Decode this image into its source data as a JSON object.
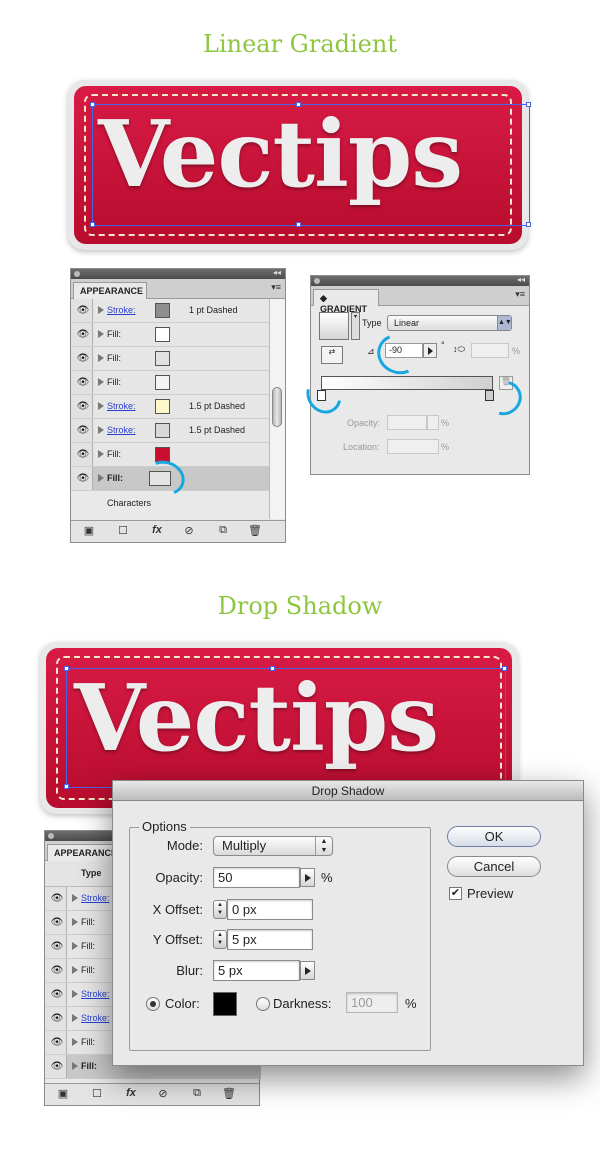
{
  "headings": {
    "linear": "Linear Gradient",
    "shadow": "Drop Shadow"
  },
  "badge": {
    "text": "Vectips",
    "color_top": "#d81b45",
    "color_bottom": "#b80c2e",
    "stitch": "#f3e8c8"
  },
  "appearance1": {
    "tab": "APPEARANCE",
    "rows": [
      {
        "label": "Stroke:",
        "link": true,
        "swatch": "#8e8e8e",
        "value": "1 pt Dashed"
      },
      {
        "label": "Fill:",
        "link": false,
        "swatch": "#ffffff",
        "value": ""
      },
      {
        "label": "Fill:",
        "link": false,
        "swatch": "#e1e1e1",
        "value": ""
      },
      {
        "label": "Fill:",
        "link": false,
        "swatch": "#f4f4f4",
        "value": ""
      },
      {
        "label": "Stroke:",
        "link": true,
        "swatch": "#fff8c8",
        "value": "1.5 pt Dashed"
      },
      {
        "label": "Stroke:",
        "link": true,
        "swatch": "#d8d8d8",
        "value": "1.5 pt Dashed"
      },
      {
        "label": "Fill:",
        "link": false,
        "swatch": "#c8102e",
        "value": ""
      },
      {
        "label": "Fill:",
        "link": false,
        "swatch": "#e4e4e4",
        "value": ""
      }
    ],
    "characters": "Characters",
    "toolbar": {
      "fx": "fx"
    }
  },
  "gradient": {
    "tab": "GRADIENT",
    "type_label": "Type",
    "type_value": "Linear",
    "angle": "-90",
    "degree": "°",
    "percent": "%",
    "opacity_label": "Opacity:",
    "location_label": "Location:"
  },
  "appearance2": {
    "tab": "APPEARANCE",
    "type_header": "Type",
    "rows": [
      {
        "label": "Stroke:",
        "link": true
      },
      {
        "label": "Fill:",
        "link": false
      },
      {
        "label": "Fill:",
        "link": false
      },
      {
        "label": "Fill:",
        "link": false
      },
      {
        "label": "Stroke:",
        "link": true
      },
      {
        "label": "Stroke:",
        "link": true
      },
      {
        "label": "Fill:",
        "link": false
      },
      {
        "label": "Fill:",
        "link": false
      }
    ],
    "fx": "fx"
  },
  "dropshadow": {
    "title": "Drop Shadow",
    "options": "Options",
    "mode_label": "Mode:",
    "mode_value": "Multiply",
    "opacity_label": "Opacity:",
    "opacity_value": "50",
    "percent": "%",
    "x_label": "X Offset:",
    "x_value": "0 px",
    "y_label": "Y Offset:",
    "y_value": "5 px",
    "blur_label": "Blur:",
    "blur_value": "5 px",
    "color_label": "Color:",
    "color_value": "#000000",
    "darkness_label": "Darkness:",
    "darkness_value": "100",
    "ok": "OK",
    "cancel": "Cancel",
    "preview": "Preview"
  }
}
